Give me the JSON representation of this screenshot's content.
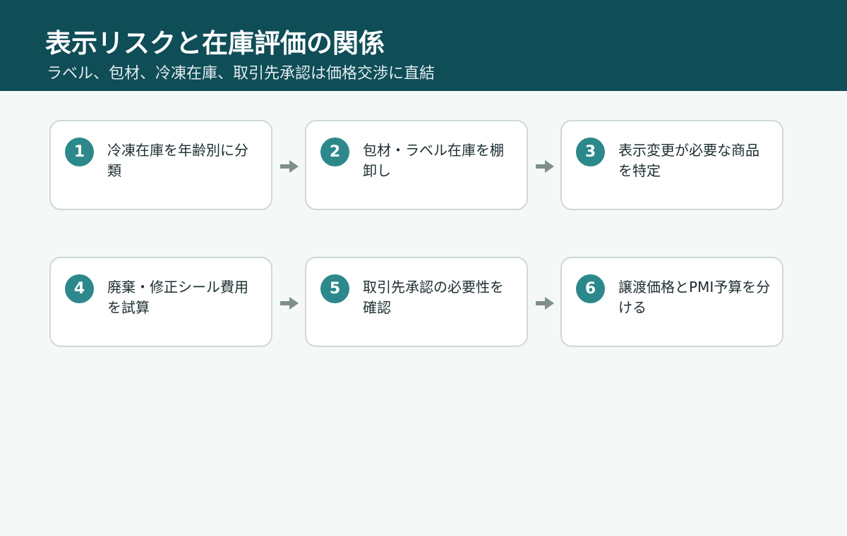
{
  "header": {
    "title": "表示リスクと在庫評価の関係",
    "subtitle": "ラベル、包材、冷凍在庫、取引先承認は価格交渉に直結"
  },
  "steps": [
    {
      "number": "1",
      "text": "冷凍在庫を年齢別に分類"
    },
    {
      "number": "2",
      "text": "包材・ラベル在庫を棚卸し"
    },
    {
      "number": "3",
      "text": "表示変更が必要な商品を特定"
    },
    {
      "number": "4",
      "text": "廃棄・修正シール費用を試算"
    },
    {
      "number": "5",
      "text": "取引先承認の必要性を確認"
    },
    {
      "number": "6",
      "text": "譲渡価格とPMI予算を分ける"
    }
  ],
  "colors": {
    "header_bg": "#0f4d57",
    "badge": "#2c888b",
    "arrow": "#7f8d8d",
    "card_border": "#cdd9d8"
  }
}
